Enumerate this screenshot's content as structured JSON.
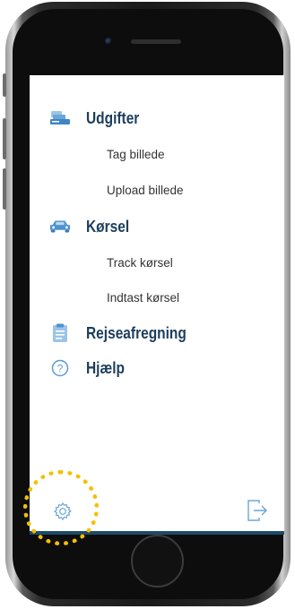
{
  "menu": {
    "sections": [
      {
        "label": "Udgifter",
        "icon": "receipt-icon"
      },
      {
        "label": "Kørsel",
        "icon": "car-icon"
      },
      {
        "label": "Rejseafregning",
        "icon": "document-icon"
      },
      {
        "label": "Hjælp",
        "icon": "help-icon"
      }
    ],
    "udgifter_items": [
      "Tag billede",
      "Upload billede"
    ],
    "korsel_items": [
      "Track kørsel",
      "Indtast kørsel"
    ]
  },
  "footer": {
    "settings_icon": "gear-icon",
    "logout_icon": "logout-icon"
  },
  "colors": {
    "accent": "#1d3e5c",
    "icon_blue": "#5a9bd4",
    "highlight": "#f4c000",
    "bottom_bar": "#1e4a66"
  }
}
